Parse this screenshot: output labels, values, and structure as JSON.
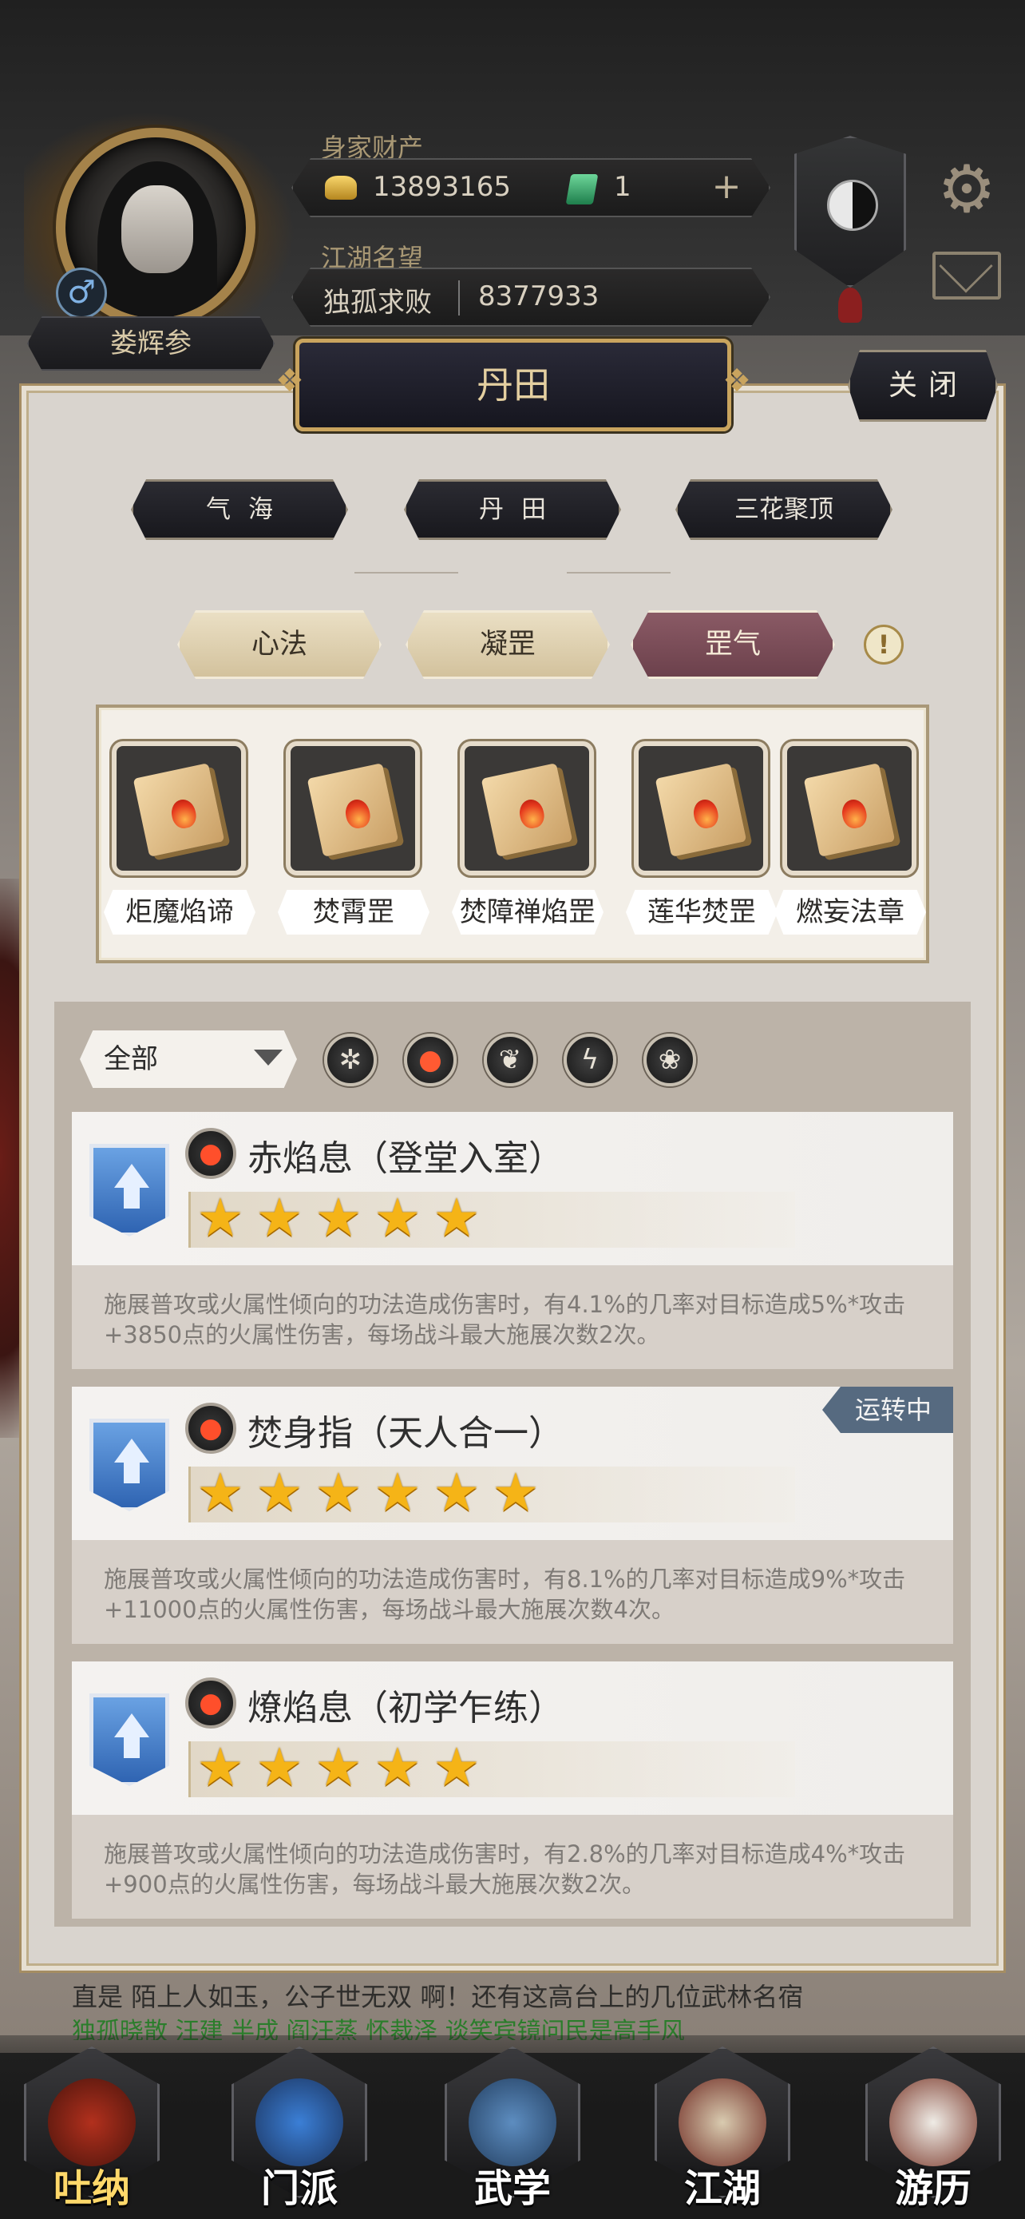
{
  "player": {
    "name": "娄辉参",
    "gender_symbol": "♂",
    "wealth_label": "身家财产",
    "gold": "13893165",
    "jade": "1",
    "plus": "+",
    "fame_label": "江湖名望",
    "fame_title": "独孤求败",
    "fame_value": "8377933"
  },
  "panel": {
    "title": "丹田",
    "close_label": "关闭",
    "main_tabs": [
      "气海",
      "丹田",
      "三花聚顶"
    ],
    "active_main_tab": "丹田",
    "sub_tabs": [
      "心法",
      "凝罡",
      "罡气"
    ],
    "active_sub_tab": "罡气",
    "info_symbol": "!"
  },
  "books": [
    {
      "label": "炬魔焰谛"
    },
    {
      "label": "焚霄罡"
    },
    {
      "label": "焚障禅焰罡"
    },
    {
      "label": "莲华焚罡"
    },
    {
      "label": "燃妄法章"
    }
  ],
  "filter": {
    "selected": "全部",
    "elements": [
      {
        "name": "all",
        "glyph": "✲"
      },
      {
        "name": "fire",
        "glyph": "🔥"
      },
      {
        "name": "wood",
        "glyph": "❦"
      },
      {
        "name": "thunder",
        "glyph": "ϟ"
      },
      {
        "name": "lotus",
        "glyph": "❀"
      }
    ]
  },
  "skills": [
    {
      "name": "赤焰息（登堂入室）",
      "stars": 5,
      "running": false,
      "description": "施展普攻或火属性倾向的功法造成伤害时，有4.1%的几率对目标造成5%*攻击+3850点的火属性伤害，每场战斗最大施展次数2次。"
    },
    {
      "name": "焚身指（天人合一）",
      "stars": 6,
      "running": true,
      "running_label": "运转中",
      "description": "施展普攻或火属性倾向的功法造成伤害时，有8.1%的几率对目标造成9%*攻击+11000点的火属性伤害，每场战斗最大施展次数4次。"
    },
    {
      "name": "燎焰息（初学乍练）",
      "stars": 5,
      "running": false,
      "description": "施展普攻或火属性倾向的功法造成伤害时，有2.8%的几率对目标造成4%*攻击+900点的火属性伤害，每场战斗最大施展次数2次。"
    }
  ],
  "chat": {
    "line1": "直是 陌上人如玉，公子世无双 啊！还有这高台上的几位武林名宿",
    "line2": "独孤晓散  汪建  半成  阎汪蒸  怀裁泽  谈笑宾镜问民是高手风"
  },
  "bottom_nav": [
    {
      "label": "吐纳",
      "active": true
    },
    {
      "label": "门派",
      "active": false
    },
    {
      "label": "武学",
      "active": false
    },
    {
      "label": "江湖",
      "active": false
    },
    {
      "label": "游历",
      "active": false
    }
  ],
  "colors": {
    "panel_bg": "#d9d4ce",
    "active_subtab": "#7a4d58",
    "star": "#f5b417",
    "rank_banner": "#3f76c4",
    "running_tag": "#566a80"
  }
}
